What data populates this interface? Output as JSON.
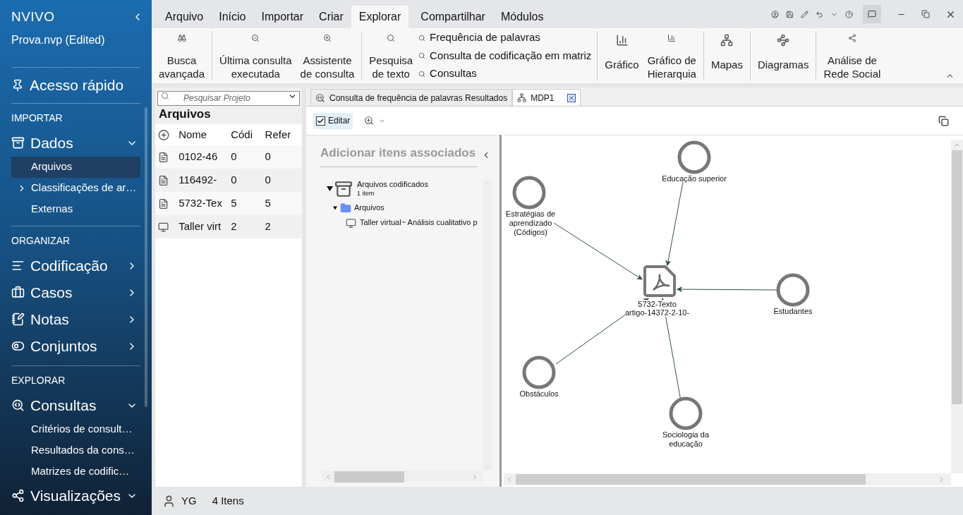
{
  "app": {
    "logo": "NVIVO",
    "project": "Prova.nvp (Edited)"
  },
  "sidebar": {
    "quick_access": "Acesso rápido",
    "sections": [
      {
        "title": "IMPORTAR",
        "items": [
          {
            "label": "Dados",
            "expanded": true,
            "children": [
              {
                "label": "Arquivos",
                "selected": true,
                "kind": "leaf"
              },
              {
                "label": "Classificações de ar…",
                "selected": false,
                "kind": "group",
                "expanded": false
              },
              {
                "label": "Externas",
                "selected": false,
                "kind": "leaf"
              }
            ]
          }
        ]
      },
      {
        "title": "ORGANIZAR",
        "items": [
          {
            "label": "Codificação",
            "expanded": false
          },
          {
            "label": "Casos",
            "expanded": false
          },
          {
            "label": "Notas",
            "expanded": false
          },
          {
            "label": "Conjuntos",
            "expanded": false
          }
        ]
      },
      {
        "title": "EXPLORAR",
        "items": [
          {
            "label": "Consultas",
            "expanded": true,
            "children": [
              {
                "label": "Critérios de consult…",
                "selected": false,
                "kind": "leaf"
              },
              {
                "label": "Resultados da cons…",
                "selected": false,
                "kind": "leaf"
              },
              {
                "label": "Matrizes de codific…",
                "selected": false,
                "kind": "leaf"
              }
            ]
          },
          {
            "label": "Visualizações",
            "expanded": true
          }
        ]
      }
    ]
  },
  "menu_tabs": [
    {
      "label": "Arquivo",
      "selected": false
    },
    {
      "label": "Início",
      "selected": false
    },
    {
      "label": "Importar",
      "selected": false
    },
    {
      "label": "Criar",
      "selected": false
    },
    {
      "label": "Explorar",
      "selected": true
    },
    {
      "label": "Compartilhar",
      "selected": false
    },
    {
      "label": "Módulos",
      "selected": false
    }
  ],
  "ribbon_groups": [
    [
      {
        "kind": "large",
        "lines": [
          "Busca",
          "avançada"
        ]
      }
    ],
    [
      {
        "kind": "large",
        "lines": [
          "Última consulta",
          "executada"
        ]
      },
      {
        "kind": "large",
        "lines": [
          "Assistente",
          "de consulta"
        ]
      }
    ],
    [
      {
        "kind": "large",
        "lines": [
          "Pesquisa",
          "de texto"
        ]
      },
      {
        "kind": "stack",
        "entries": [
          "Frequência de palavras",
          "Consulta de codificação em matriz",
          "Consultas"
        ]
      }
    ],
    [
      {
        "kind": "large",
        "lines": [
          "Gráfico"
        ]
      },
      {
        "kind": "large",
        "lines": [
          "Gráfico de",
          "Hierarquia"
        ]
      }
    ],
    [
      {
        "kind": "large",
        "lines": [
          "Mapas"
        ]
      }
    ],
    [
      {
        "kind": "large",
        "lines": [
          "Diagramas"
        ]
      }
    ],
    [
      {
        "kind": "large",
        "lines": [
          "Análise de",
          "Rede Social"
        ]
      }
    ]
  ],
  "files_panel": {
    "search": {
      "placeholder": "Pesquisar Projeto"
    },
    "title": "Arquivos",
    "columns": [
      "Nome",
      "Códi",
      "Refer"
    ],
    "rows": [
      {
        "kind": "pdf",
        "cells": [
          "0102-46",
          "0",
          "0"
        ]
      },
      {
        "kind": "pdf",
        "cells": [
          "116492-",
          "0",
          "0"
        ]
      },
      {
        "kind": "pdf",
        "cells": [
          "5732-Tex",
          "5",
          "5"
        ]
      },
      {
        "kind": "video",
        "cells": [
          "Taller virt",
          "2",
          "2"
        ]
      }
    ]
  },
  "doc_tabs": [
    {
      "label": "Consulta de frequência de palavras Resultados",
      "selected": false
    },
    {
      "label": "MDP1",
      "selected": true
    }
  ],
  "toolbar": {
    "edit": {
      "label": "Editar",
      "checked": true
    }
  },
  "associated": {
    "title": "Adicionar itens associados",
    "tree": [
      {
        "label": "Arquivos codificados",
        "sublabel": "1 item",
        "kind": "cabinet",
        "expanded": true,
        "children": [
          {
            "label": "Arquivos",
            "kind": "folder",
            "expanded": true,
            "children": [
              {
                "label": "Taller virtual~ Análisis cualitativo p",
                "kind": "video"
              }
            ]
          }
        ]
      }
    ]
  },
  "map": {
    "center": {
      "lines": [
        "5732-Texto",
        "artigo-14372-2-10-"
      ]
    },
    "nodes": [
      {
        "lines": [
          "Educação superior"
        ]
      },
      {
        "lines": [
          "Estratégias de",
          "aprendizado",
          "(Códigos)"
        ]
      },
      {
        "lines": [
          "Estudantes"
        ]
      },
      {
        "lines": [
          "Obstáculos"
        ]
      },
      {
        "lines": [
          "Sociologia da",
          "educação"
        ]
      }
    ]
  },
  "status_bar": {
    "user": "YG",
    "count": "4 Itens"
  }
}
